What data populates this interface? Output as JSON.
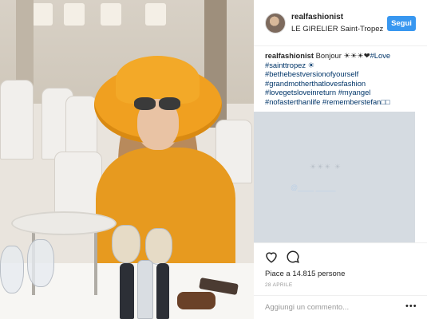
{
  "header": {
    "username": "realfashionist",
    "location": "LE GIRELIER Saint-Tropez",
    "follow_label": "Segui"
  },
  "caption": {
    "username": "realfashionist",
    "text_start": "Bonjour ☀☀☀❤",
    "first_tag": "#Love",
    "tag2": "#sainttropez ☀",
    "tags": [
      "#bethebestversionofyourself",
      "#grandmotherthatlovesfashion",
      "#lovegetsloveinreturn #myangel",
      "#nofasterthanlife #rememberstefan□□"
    ]
  },
  "blurred_comment": {
    "line1": "☀☀☀ ☀",
    "line2": "@____ _____"
  },
  "actions": {
    "like_icon": "heart-icon",
    "comment_icon": "comment-icon",
    "likes_text": "Piace a 14.815 persone",
    "date": "28 APRILE"
  },
  "comment_box": {
    "placeholder": "Aggiungi un commento...",
    "more_label": "•••"
  },
  "colors": {
    "follow_button": "#3897f0",
    "hashtag": "#003569",
    "hat": "#f0a020"
  }
}
